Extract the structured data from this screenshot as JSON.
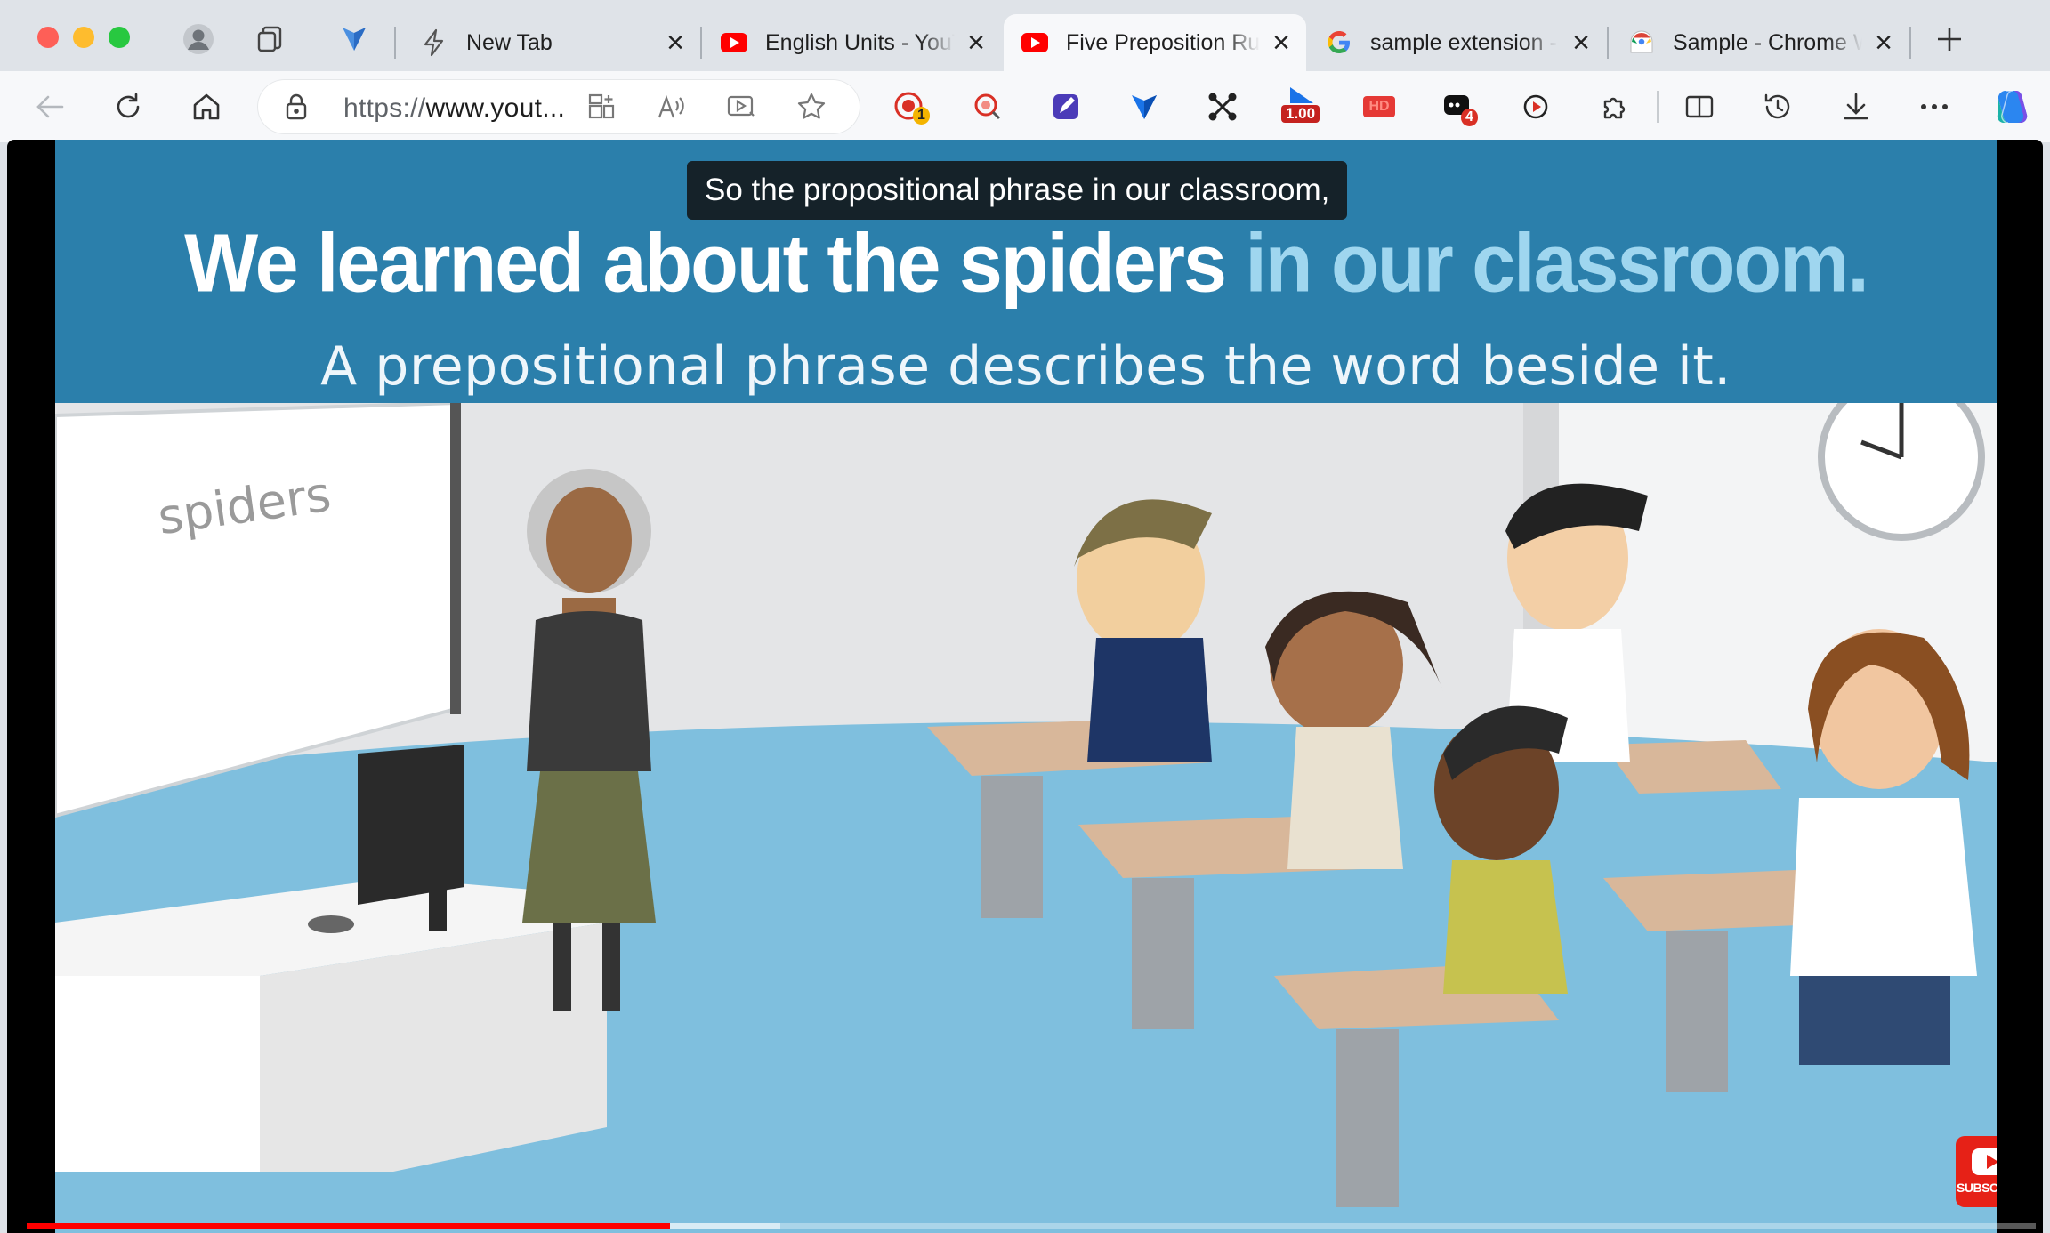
{
  "tabs": [
    {
      "title": "New Tab",
      "active": false
    },
    {
      "title": "English Units - YouTube",
      "active": false
    },
    {
      "title": "Five Preposition Rules",
      "active": true
    },
    {
      "title": "sample extension - Google Search",
      "active": false
    },
    {
      "title": "Sample - Chrome Web Store",
      "active": false
    }
  ],
  "address": {
    "scheme": "https://",
    "host": "www.yout..."
  },
  "extensions": {
    "record_badge": "1",
    "speed_badge": "1.00",
    "hd_label": "HD",
    "notif_badge": "4"
  },
  "video": {
    "caption": "So the propositional phrase in our classroom,",
    "headline_plain": "We learned about the spiders",
    "headline_highlight": "in our classroom.",
    "subline": "A prepositional phrase describes the word beside it.",
    "board_text": "spiders",
    "subscribe_label": "SUBSCRIBE",
    "played_fraction": 0.32,
    "buffered_fraction": 0.375
  },
  "colors": {
    "banner": "#2b7fab",
    "highlight": "#9fd6ef",
    "progress": "#ff0000",
    "floor": "#7fbfde"
  }
}
